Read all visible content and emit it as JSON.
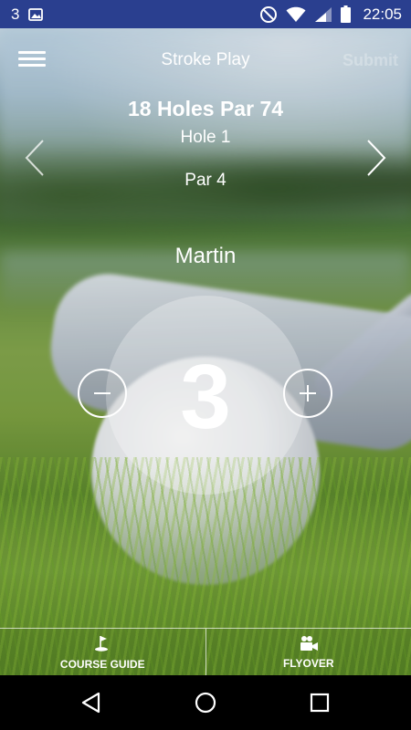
{
  "status_bar": {
    "notification_count": "3",
    "time": "22:05",
    "icons": [
      "image-icon",
      "do-not-disturb-icon",
      "wifi-icon",
      "signal-icon",
      "battery-icon"
    ]
  },
  "app_bar": {
    "title": "Stroke Play",
    "submit_label": "Submit",
    "menu_icon": "hamburger-menu-icon"
  },
  "course": {
    "title": "18 Holes Par 74",
    "hole": "Hole 1",
    "par": "Par 4"
  },
  "player": {
    "name": "Martin",
    "score": "3"
  },
  "tabs": [
    {
      "label": "COURSE GUIDE",
      "icon": "golf-flag-icon"
    },
    {
      "label": "FLYOVER",
      "icon": "video-camera-icon"
    }
  ],
  "colors": {
    "status_bar": "#2a3f8f",
    "text": "#ffffff",
    "submit_disabled": "rgba(255,255,255,0.28)"
  }
}
